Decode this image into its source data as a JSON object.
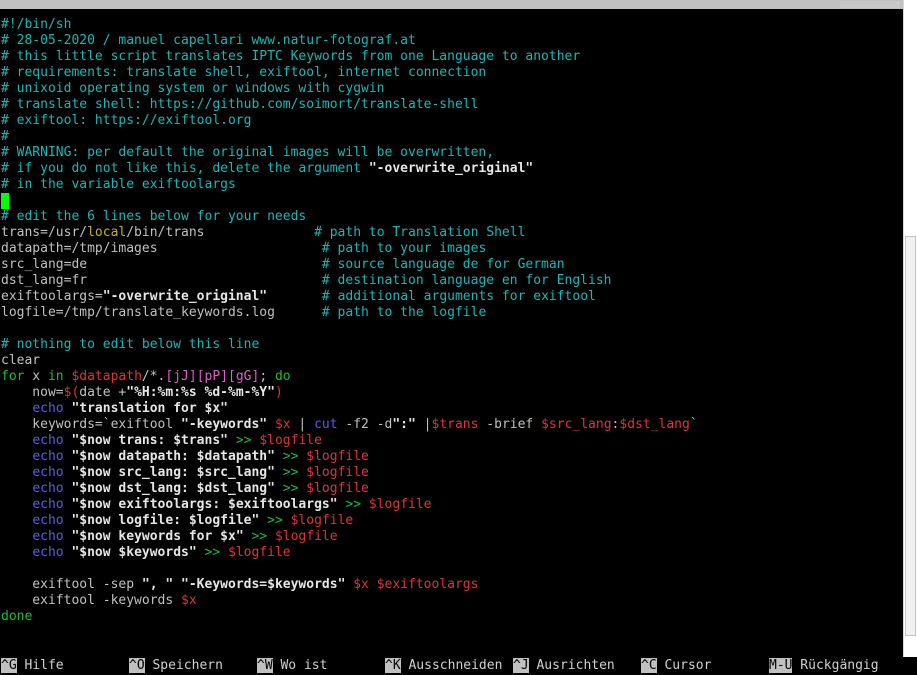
{
  "editor": {
    "lines": [
      [
        {
          "t": "#!/bin/sh",
          "c": "comment"
        }
      ],
      [
        {
          "t": "# 28-05-2020 / manuel capellari www.natur-fotograf.at",
          "c": "comment"
        }
      ],
      [
        {
          "t": "# this little script translates IPTC Keywords from one Language to another",
          "c": "comment"
        }
      ],
      [
        {
          "t": "# requirements: translate shell, exiftool, internet connection",
          "c": "comment"
        }
      ],
      [
        {
          "t": "# unixoid operating system or windows with cygwin",
          "c": "comment"
        }
      ],
      [
        {
          "t": "# translate shell: https://github.com/soimort/translate-shell",
          "c": "comment"
        }
      ],
      [
        {
          "t": "# exiftool: https://exiftool.org",
          "c": "comment"
        }
      ],
      [
        {
          "t": "#",
          "c": "comment"
        }
      ],
      [
        {
          "t": "# WARNING: per default the original images will be overwritten,",
          "c": "comment"
        }
      ],
      [
        {
          "t": "# if you do not like this, delete the argument ",
          "c": "comment"
        },
        {
          "t": "\"-overwrite_original\"",
          "c": "str"
        }
      ],
      [
        {
          "t": "# in the variable exiftoolargs",
          "c": "comment"
        }
      ],
      [
        {
          "t": " ",
          "c": "cursor"
        }
      ],
      [
        {
          "t": "# edit the 6 lines below for your needs",
          "c": "comment"
        }
      ],
      [
        {
          "t": "trans=/usr/",
          "c": "plain"
        },
        {
          "t": "local",
          "c": "path"
        },
        {
          "t": "/bin/trans              ",
          "c": "plain"
        },
        {
          "t": "# path to Translation Shell",
          "c": "comment"
        }
      ],
      [
        {
          "t": "datapath=/tmp/images                     ",
          "c": "plain"
        },
        {
          "t": "# path to your images",
          "c": "comment"
        }
      ],
      [
        {
          "t": "src_lang=de                              ",
          "c": "plain"
        },
        {
          "t": "# source language de for German",
          "c": "comment"
        }
      ],
      [
        {
          "t": "dst_lang=fr                              ",
          "c": "plain"
        },
        {
          "t": "# destination language en for English",
          "c": "comment"
        }
      ],
      [
        {
          "t": "exiftoolargs=",
          "c": "plain"
        },
        {
          "t": "\"-overwrite_original\"",
          "c": "str"
        },
        {
          "t": "       ",
          "c": "plain"
        },
        {
          "t": "# additional arguments for exiftool",
          "c": "comment"
        }
      ],
      [
        {
          "t": "logfile=/tmp/translate_keywords.log      ",
          "c": "plain"
        },
        {
          "t": "# path to the logfile",
          "c": "comment"
        }
      ],
      [
        {
          "t": "",
          "c": "plain"
        }
      ],
      [
        {
          "t": "# nothing to edit below this line",
          "c": "comment"
        }
      ],
      [
        {
          "t": "clear",
          "c": "plain"
        }
      ],
      [
        {
          "t": "for",
          "c": "kw"
        },
        {
          "t": " x ",
          "c": "plain"
        },
        {
          "t": "in",
          "c": "kw"
        },
        {
          "t": " ",
          "c": "plain"
        },
        {
          "t": "$datapath",
          "c": "var"
        },
        {
          "t": "/*.",
          "c": "plain"
        },
        {
          "t": "[jJ][pP][gG]",
          "c": "bracket"
        },
        {
          "t": "; ",
          "c": "plain"
        },
        {
          "t": "do",
          "c": "kw"
        }
      ],
      [
        {
          "t": "    now=",
          "c": "plain"
        },
        {
          "t": "$(",
          "c": "var"
        },
        {
          "t": "date +",
          "c": "plain"
        },
        {
          "t": "\"%H:%m:%s %d-%m-%Y\"",
          "c": "str"
        },
        {
          "t": ")",
          "c": "var"
        }
      ],
      [
        {
          "t": "    ",
          "c": "plain"
        },
        {
          "t": "echo",
          "c": "cmd"
        },
        {
          "t": " ",
          "c": "plain"
        },
        {
          "t": "\"translation for $x\"",
          "c": "str"
        }
      ],
      [
        {
          "t": "    keywords=`exiftool ",
          "c": "plain"
        },
        {
          "t": "\"-keywords\"",
          "c": "str"
        },
        {
          "t": " ",
          "c": "plain"
        },
        {
          "t": "$x",
          "c": "var"
        },
        {
          "t": " | ",
          "c": "plain"
        },
        {
          "t": "cut",
          "c": "cmd"
        },
        {
          "t": " -f2 -d",
          "c": "plain"
        },
        {
          "t": "\":\"",
          "c": "str"
        },
        {
          "t": " |",
          "c": "plain"
        },
        {
          "t": "$trans",
          "c": "var"
        },
        {
          "t": " -brief ",
          "c": "plain"
        },
        {
          "t": "$src_lang",
          "c": "var"
        },
        {
          "t": ":",
          "c": "plain"
        },
        {
          "t": "$dst_lang",
          "c": "var"
        },
        {
          "t": "`",
          "c": "plain"
        }
      ],
      [
        {
          "t": "    ",
          "c": "plain"
        },
        {
          "t": "echo",
          "c": "cmd"
        },
        {
          "t": " ",
          "c": "plain"
        },
        {
          "t": "\"$now trans: $trans\"",
          "c": "str"
        },
        {
          "t": " >> ",
          "c": "kw"
        },
        {
          "t": "$logfile",
          "c": "var"
        }
      ],
      [
        {
          "t": "    ",
          "c": "plain"
        },
        {
          "t": "echo",
          "c": "cmd"
        },
        {
          "t": " ",
          "c": "plain"
        },
        {
          "t": "\"$now datapath: $datapath\"",
          "c": "str"
        },
        {
          "t": " >> ",
          "c": "kw"
        },
        {
          "t": "$logfile",
          "c": "var"
        }
      ],
      [
        {
          "t": "    ",
          "c": "plain"
        },
        {
          "t": "echo",
          "c": "cmd"
        },
        {
          "t": " ",
          "c": "plain"
        },
        {
          "t": "\"$now src_lang: $src_lang\"",
          "c": "str"
        },
        {
          "t": " >> ",
          "c": "kw"
        },
        {
          "t": "$logfile",
          "c": "var"
        }
      ],
      [
        {
          "t": "    ",
          "c": "plain"
        },
        {
          "t": "echo",
          "c": "cmd"
        },
        {
          "t": " ",
          "c": "plain"
        },
        {
          "t": "\"$now dst_lang: $dst_lang\"",
          "c": "str"
        },
        {
          "t": " >> ",
          "c": "kw"
        },
        {
          "t": "$logfile",
          "c": "var"
        }
      ],
      [
        {
          "t": "    ",
          "c": "plain"
        },
        {
          "t": "echo",
          "c": "cmd"
        },
        {
          "t": " ",
          "c": "plain"
        },
        {
          "t": "\"$now exiftoolargs: $exiftoolargs\"",
          "c": "str"
        },
        {
          "t": " >> ",
          "c": "kw"
        },
        {
          "t": "$logfile",
          "c": "var"
        }
      ],
      [
        {
          "t": "    ",
          "c": "plain"
        },
        {
          "t": "echo",
          "c": "cmd"
        },
        {
          "t": " ",
          "c": "plain"
        },
        {
          "t": "\"$now logfile: $logfile\"",
          "c": "str"
        },
        {
          "t": " >> ",
          "c": "kw"
        },
        {
          "t": "$logfile",
          "c": "var"
        }
      ],
      [
        {
          "t": "    ",
          "c": "plain"
        },
        {
          "t": "echo",
          "c": "cmd"
        },
        {
          "t": " ",
          "c": "plain"
        },
        {
          "t": "\"$now keywords for $x\"",
          "c": "str"
        },
        {
          "t": " >> ",
          "c": "kw"
        },
        {
          "t": "$logfile",
          "c": "var"
        }
      ],
      [
        {
          "t": "    ",
          "c": "plain"
        },
        {
          "t": "echo",
          "c": "cmd"
        },
        {
          "t": " ",
          "c": "plain"
        },
        {
          "t": "\"$now $keywords\"",
          "c": "str"
        },
        {
          "t": " >> ",
          "c": "kw"
        },
        {
          "t": "$logfile",
          "c": "var"
        }
      ],
      [
        {
          "t": "",
          "c": "plain"
        }
      ],
      [
        {
          "t": "    exiftool -sep ",
          "c": "plain"
        },
        {
          "t": "\", \"",
          "c": "str"
        },
        {
          "t": " ",
          "c": "plain"
        },
        {
          "t": "\"-Keywords=$keywords\"",
          "c": "str"
        },
        {
          "t": " ",
          "c": "plain"
        },
        {
          "t": "$x",
          "c": "var"
        },
        {
          "t": " ",
          "c": "plain"
        },
        {
          "t": "$exiftoolargs",
          "c": "var"
        }
      ],
      [
        {
          "t": "    exiftool -keywords ",
          "c": "plain"
        },
        {
          "t": "$x",
          "c": "var"
        }
      ],
      [
        {
          "t": "done",
          "c": "kw"
        }
      ]
    ]
  },
  "shortcuts": [
    {
      "key": "^G",
      "label": "Hilfe"
    },
    {
      "key": "^O",
      "label": "Speichern"
    },
    {
      "key": "^W",
      "label": "Wo ist"
    },
    {
      "key": "^K",
      "label": "Ausschneiden"
    },
    {
      "key": "^J",
      "label": "Ausrichten"
    },
    {
      "key": "^C",
      "label": "Cursor"
    },
    {
      "key": "M-U",
      "label": "Rückgängig"
    }
  ],
  "colors": {
    "background": "#000000",
    "comment": "#19b8b8",
    "keyword": "#1ebc3c",
    "variable": "#e03434",
    "command": "#5a5aee",
    "cursor": "#00ff00"
  }
}
